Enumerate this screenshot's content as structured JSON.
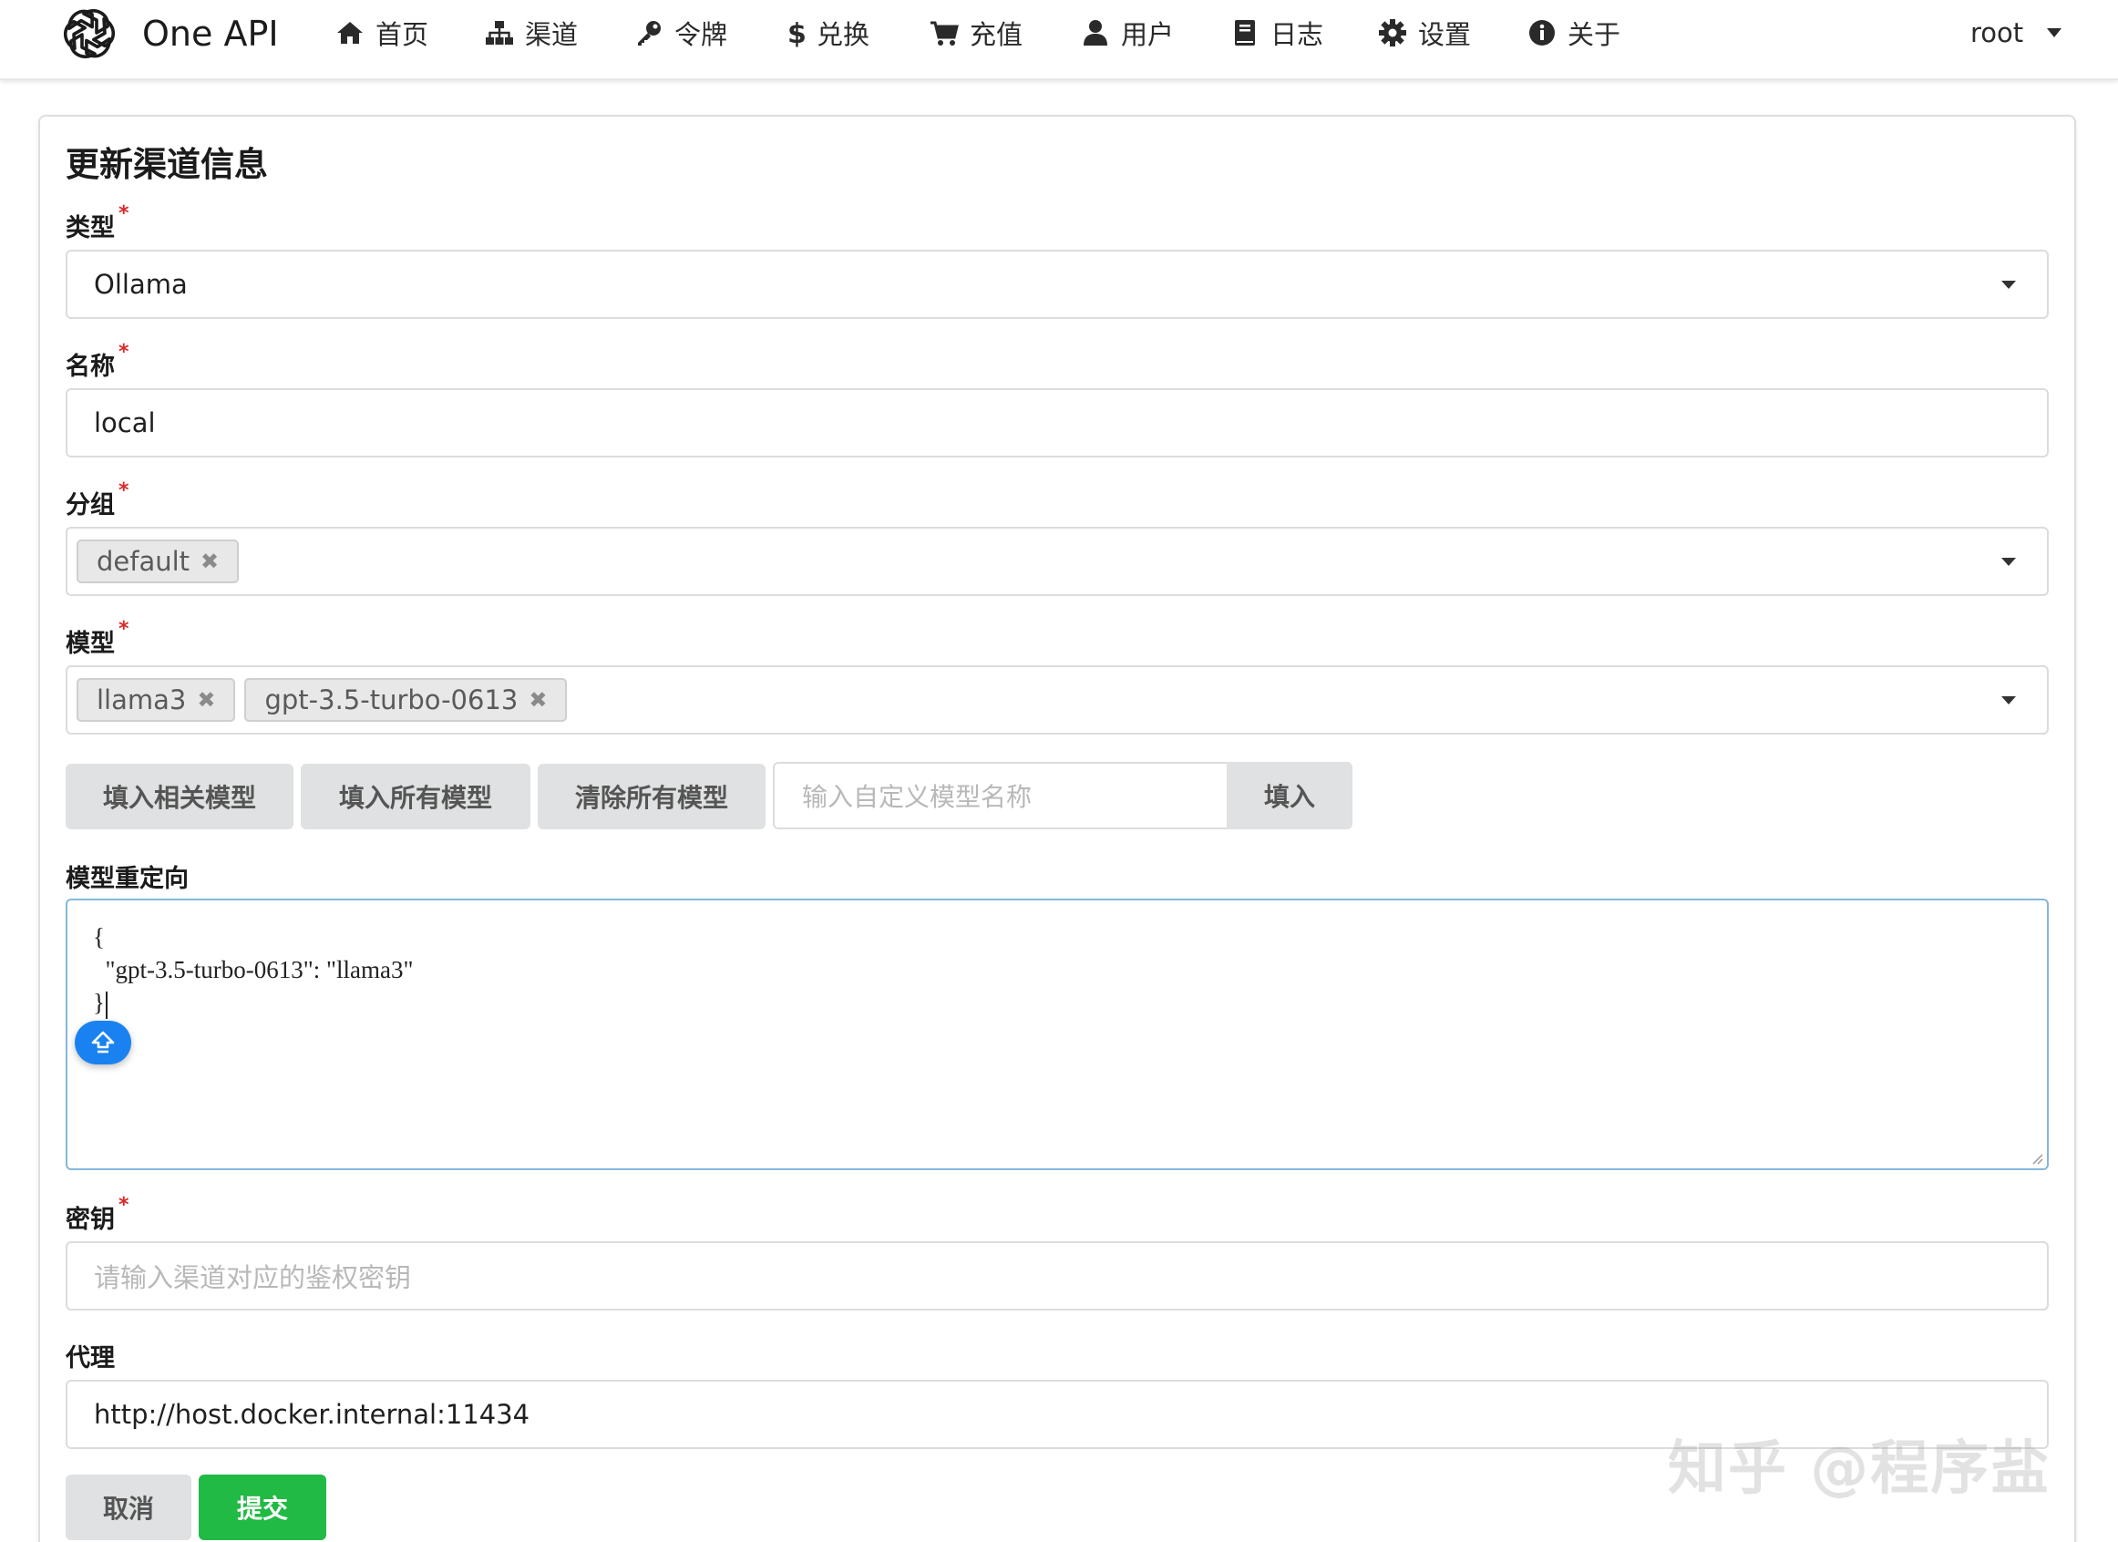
{
  "app": {
    "name": "One API"
  },
  "nav": {
    "items": [
      {
        "label": "首页",
        "icon": "home-icon"
      },
      {
        "label": "渠道",
        "icon": "sitemap-icon"
      },
      {
        "label": "令牌",
        "icon": "key-icon"
      },
      {
        "label": "兑换",
        "icon": "dollar-icon"
      },
      {
        "label": "充值",
        "icon": "cart-icon"
      },
      {
        "label": "用户",
        "icon": "user-icon"
      },
      {
        "label": "日志",
        "icon": "book-icon"
      },
      {
        "label": "设置",
        "icon": "gear-icon"
      },
      {
        "label": "关于",
        "icon": "info-circle-icon"
      }
    ],
    "user": "root"
  },
  "form": {
    "title": "更新渠道信息",
    "type": {
      "label": "类型",
      "value": "Ollama"
    },
    "name": {
      "label": "名称",
      "value": "local"
    },
    "group": {
      "label": "分组",
      "tags": [
        "default"
      ]
    },
    "models": {
      "label": "模型",
      "tags": [
        "llama3",
        "gpt-3.5-turbo-0613"
      ]
    },
    "model_buttons": {
      "fill_related": "填入相关模型",
      "fill_all": "填入所有模型",
      "clear_all": "清除所有模型",
      "custom_placeholder": "输入自定义模型名称",
      "fill": "填入"
    },
    "model_mapping": {
      "label": "模型重定向",
      "line1": "{",
      "line2": "  \"gpt-3.5-turbo-0613\": \"llama3\"",
      "line3": "}"
    },
    "key": {
      "label": "密钥",
      "placeholder": "请输入渠道对应的鉴权密钥"
    },
    "proxy": {
      "label": "代理",
      "value": "http://host.docker.internal:11434"
    },
    "required_mark": "*",
    "cancel": "取消",
    "submit": "提交"
  },
  "watermark": "知乎 @程序盐",
  "colors": {
    "submit": "#21ba45",
    "focus_border": "#85b7d9",
    "required": "#db2828",
    "float_button": "#1a82f0"
  }
}
